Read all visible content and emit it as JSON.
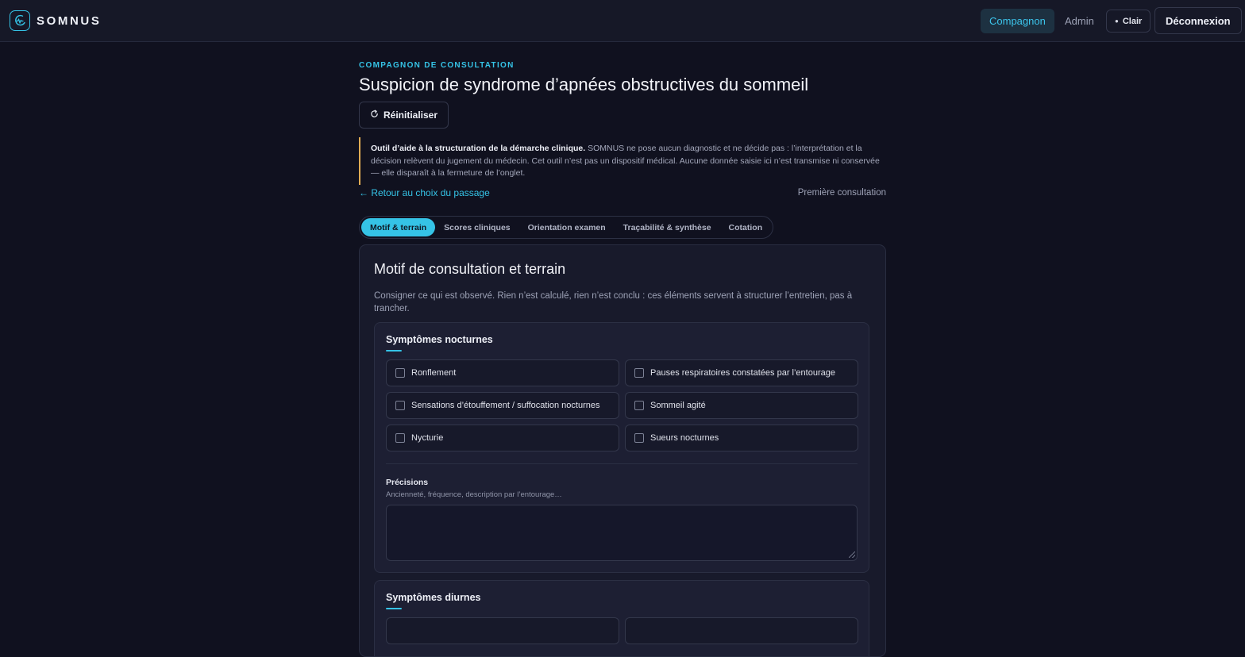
{
  "header": {
    "brand": "SOMNUS",
    "nav": [
      {
        "label": "Compagnon",
        "active": true
      },
      {
        "label": "Admin",
        "active": false
      }
    ],
    "theme_toggle": "Clair",
    "logout": "Déconnexion"
  },
  "page": {
    "eyebrow": "COMPAGNON DE CONSULTATION",
    "title": "Suspicion de syndrome d’apnées obstructives du sommeil",
    "reset_button": "Réinitialiser",
    "disclaimer_bold": "Outil d’aide à la structuration de la démarche clinique.",
    "disclaimer_text": " SOMNUS ne pose aucun diagnostic et ne décide pas : l’interprétation et la décision relèvent du jugement du médecin. Cet outil n’est pas un dispositif médical. Aucune donnée saisie ici n’est transmise ni conservée — elle disparaît à la fermeture de l’onglet.",
    "back_link": "← Retour au choix du passage",
    "visit_type": "Première consultation"
  },
  "tabs": [
    {
      "label": "Motif & terrain",
      "active": true
    },
    {
      "label": "Scores cliniques",
      "active": false
    },
    {
      "label": "Orientation examen",
      "active": false
    },
    {
      "label": "Traçabilité & synthèse",
      "active": false
    },
    {
      "label": "Cotation",
      "active": false
    }
  ],
  "card": {
    "title": "Motif de consultation et terrain",
    "description": "Consigner ce qui est observé. Rien n’est calculé, rien n’est conclu : ces éléments servent à structurer l’entretien, pas à trancher.",
    "section_nocturnal": {
      "title": "Symptômes nocturnes",
      "items": [
        "Ronflement",
        "Pauses respiratoires constatées par l’entourage",
        "Sensations d’étouffement / suffocation nocturnes",
        "Sommeil agité",
        "Nycturie",
        "Sueurs nocturnes"
      ],
      "details_label": "Précisions",
      "details_hint": "Ancienneté, fréquence, description par l’entourage…",
      "details_value": ""
    },
    "section_diurnal": {
      "title": "Symptômes diurnes"
    }
  },
  "colors": {
    "accent": "#35c3e6",
    "warning_border": "#e1ac54",
    "background": "#10111f"
  }
}
